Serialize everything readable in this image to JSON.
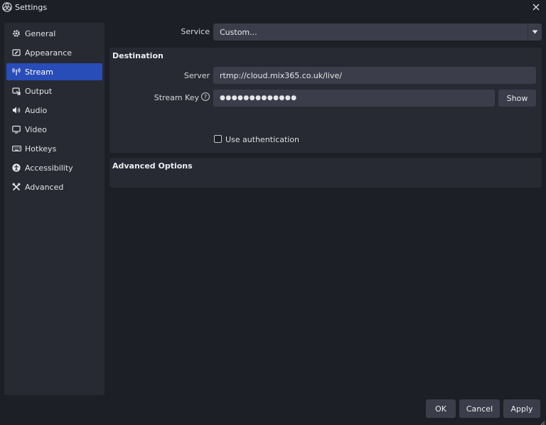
{
  "window": {
    "title": "Settings",
    "close_glyph": "×"
  },
  "sidebar": {
    "items": [
      {
        "label": "General",
        "icon": "gear-icon"
      },
      {
        "label": "Appearance",
        "icon": "appearance-icon"
      },
      {
        "label": "Stream",
        "icon": "antenna-icon",
        "active": true
      },
      {
        "label": "Output",
        "icon": "output-icon"
      },
      {
        "label": "Audio",
        "icon": "speaker-icon"
      },
      {
        "label": "Video",
        "icon": "monitor-icon"
      },
      {
        "label": "Hotkeys",
        "icon": "keyboard-icon"
      },
      {
        "label": "Accessibility",
        "icon": "accessibility-icon"
      },
      {
        "label": "Advanced",
        "icon": "tools-icon"
      }
    ]
  },
  "service": {
    "label": "Service",
    "value": "Custom..."
  },
  "destination": {
    "title": "Destination",
    "server_label": "Server",
    "server_value": "rtmp://cloud.mix365.co.uk/live/",
    "stream_key_label": "Stream Key",
    "help_glyph": "?",
    "stream_key_value": "●●●●●●●●●●●●●",
    "show_button": "Show",
    "use_auth_label": "Use authentication",
    "use_auth_checked": false
  },
  "advanced_options": {
    "title": "Advanced Options"
  },
  "footer": {
    "ok": "OK",
    "cancel": "Cancel",
    "apply": "Apply"
  },
  "colors": {
    "background": "#1d1f26",
    "panel": "#272a33",
    "control": "#3b3e4a",
    "accent": "#284cb8"
  }
}
